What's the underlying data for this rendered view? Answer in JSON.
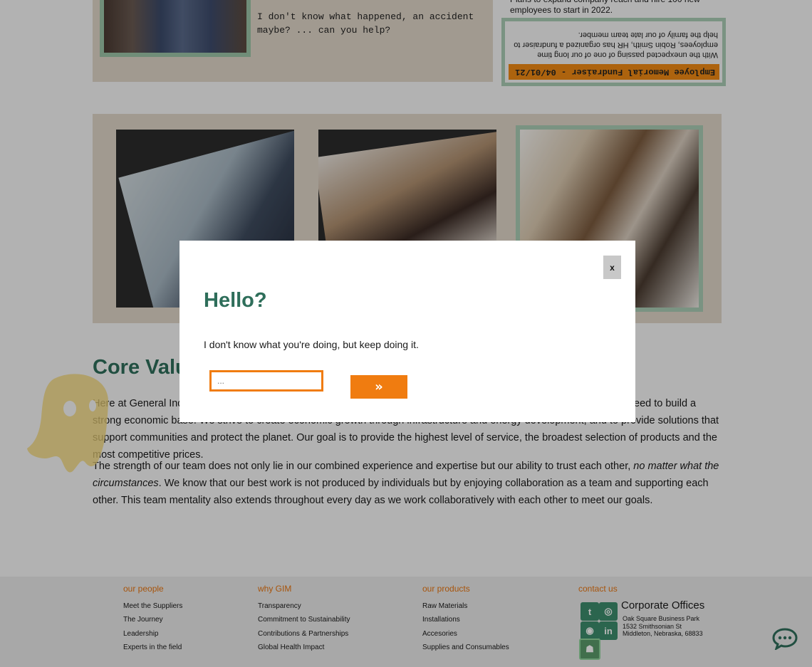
{
  "top_panel": {
    "message": "I don't know what happened, an accident\nmaybe? ... can you help?"
  },
  "news": {
    "text": "Plans to expand company reach and hire 100 new employees to start in 2022.",
    "memorial_title": "Employee Memorial Fundraiser - 04/01/21",
    "memorial_body": "With the unexpected passing of one of our long time employees, Robin Smith, HR has organized a fundraiser to help the family of our late team member."
  },
  "core_values": {
    "title": "Core Values",
    "para1": "Here at General Industries Manufacturing we support our communities and customers by providing the products they need to build a strong economic base. We strive to create economic growth through infrastructure and energy development, and to provide solutions that support communities and protect the planet. Our goal is to provide the highest level of service, the broadest selection of products and the most competitive prices.",
    "para2a": "The strength of our team does not only lie in our combined experience and expertise but our ability to trust each other, ",
    "para2_em": "no matter what the circumstances",
    "para2b": ". We know that our best work is not produced by individuals but by enjoying collaboration as a team and supporting each other. This team mentality also extends throughout every day as we work collaboratively with each other to meet our goals."
  },
  "footer": {
    "col1": {
      "heading": "our people",
      "links": [
        "Meet the Suppliers",
        "The Journey",
        "Leadership",
        "Experts in the field"
      ]
    },
    "col2": {
      "heading": "why GIM",
      "links": [
        "Transparency",
        "Commitment to Sustainability",
        "Contributions & Partnerships",
        "Global Health Impact"
      ]
    },
    "col3": {
      "heading": "our products",
      "links": [
        "Raw Materials",
        "Installations",
        "Accesories",
        "Supplies and Consumables"
      ]
    },
    "col4": {
      "heading": "contact us"
    },
    "corporate": {
      "title": "Corporate Offices",
      "line1": "Oak Square Business Park",
      "line2": "1532 Smithsonian St",
      "line3": "Middleton, Nebraska, 68833"
    },
    "social_icons": [
      "twitter-icon",
      "instagram-icon",
      "github-icon",
      "linkedin-icon",
      "ghost-icon"
    ]
  },
  "modal": {
    "close_label": "x",
    "title": "Hello?",
    "text": "I don't know what you're doing, but keep doing it.",
    "input_placeholder": "...",
    "submit_label": "»"
  },
  "colors": {
    "accent_orange": "#f07c10",
    "heading_green": "#2e6e5a",
    "frame_green": "#a9ccb4",
    "panel_tan": "#e0d6c8"
  }
}
